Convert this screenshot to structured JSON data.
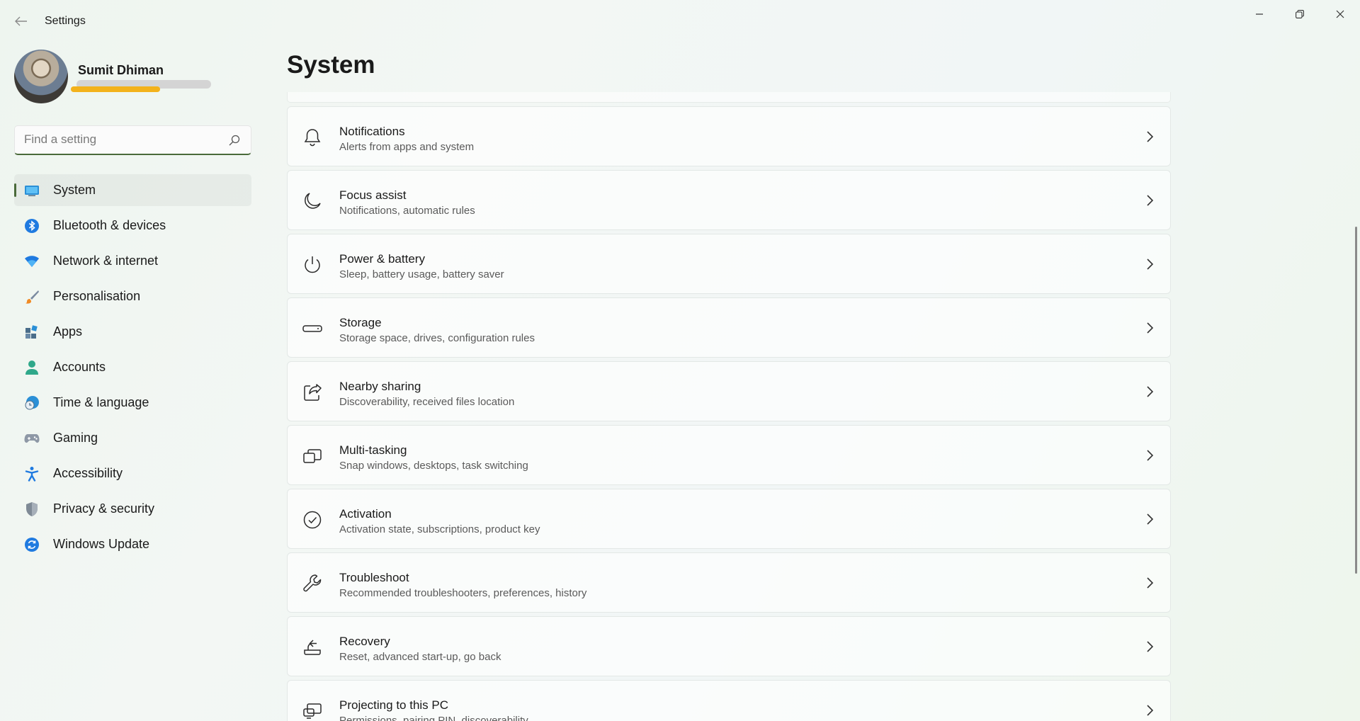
{
  "app": {
    "title": "Settings",
    "window_controls": [
      "minimize-icon",
      "restore-icon",
      "close-icon"
    ]
  },
  "profile": {
    "name": "Sumit Dhiman"
  },
  "search": {
    "placeholder": "Find a setting"
  },
  "sidebar": {
    "items": [
      {
        "label": "System",
        "icon": "system-icon",
        "active": true
      },
      {
        "label": "Bluetooth & devices",
        "icon": "bluetooth-icon"
      },
      {
        "label": "Network & internet",
        "icon": "wifi-icon"
      },
      {
        "label": "Personalisation",
        "icon": "brush-icon"
      },
      {
        "label": "Apps",
        "icon": "apps-icon"
      },
      {
        "label": "Accounts",
        "icon": "person-icon"
      },
      {
        "label": "Time & language",
        "icon": "globe-clock-icon"
      },
      {
        "label": "Gaming",
        "icon": "gamepad-icon"
      },
      {
        "label": "Accessibility",
        "icon": "accessibility-icon"
      },
      {
        "label": "Privacy & security",
        "icon": "shield-icon"
      },
      {
        "label": "Windows Update",
        "icon": "update-icon"
      }
    ]
  },
  "main": {
    "title": "System",
    "cards": [
      {
        "title": "Notifications",
        "subtitle": "Alerts from apps and system",
        "icon": "bell-icon"
      },
      {
        "title": "Focus assist",
        "subtitle": "Notifications, automatic rules",
        "icon": "moon-icon"
      },
      {
        "title": "Power & battery",
        "subtitle": "Sleep, battery usage, battery saver",
        "icon": "power-icon"
      },
      {
        "title": "Storage",
        "subtitle": "Storage space, drives, configuration rules",
        "icon": "storage-icon"
      },
      {
        "title": "Nearby sharing",
        "subtitle": "Discoverability, received files location",
        "icon": "share-icon"
      },
      {
        "title": "Multi-tasking",
        "subtitle": "Snap windows, desktops, task switching",
        "icon": "multitask-icon"
      },
      {
        "title": "Activation",
        "subtitle": "Activation state, subscriptions, product key",
        "icon": "check-circle-icon"
      },
      {
        "title": "Troubleshoot",
        "subtitle": "Recommended troubleshooters, preferences, history",
        "icon": "wrench-icon"
      },
      {
        "title": "Recovery",
        "subtitle": "Reset, advanced start-up, go back",
        "icon": "recovery-icon"
      },
      {
        "title": "Projecting to this PC",
        "subtitle": "Permissions, pairing PIN, discoverability",
        "icon": "projecting-icon"
      }
    ]
  },
  "colors": {
    "accent": "#4a6a3a",
    "profile_bar": "#f3b21b"
  }
}
